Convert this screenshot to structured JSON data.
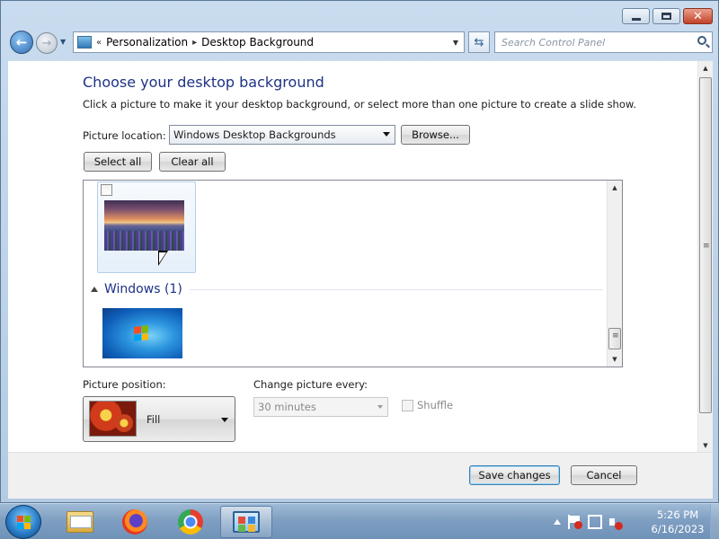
{
  "window": {
    "minimize_label": "Minimize",
    "maximize_label": "Maximize",
    "close_label": "Close"
  },
  "navbar": {
    "breadcrumb_chevron": "«",
    "breadcrumb": [
      "Personalization",
      "Desktop Background"
    ],
    "separator": "▸",
    "search_placeholder": "Search Control Panel"
  },
  "main": {
    "title": "Choose your desktop background",
    "instructions": "Click a picture to make it your desktop background, or select more than one picture to create a slide show.",
    "location_label": "Picture location:",
    "location_value": "Windows Desktop Backgrounds",
    "browse_label": "Browse...",
    "select_all_label": "Select all",
    "clear_all_label": "Clear all",
    "group_title": "Windows (1)",
    "position_label": "Picture position:",
    "position_value": "Fill",
    "change_label": "Change picture every:",
    "interval_value": "30 minutes",
    "shuffle_label": "Shuffle"
  },
  "footer": {
    "save_label": "Save changes",
    "cancel_label": "Cancel"
  },
  "taskbar": {
    "items": [
      "start",
      "windows-explorer",
      "firefox",
      "chrome",
      "control-panel"
    ],
    "time": "5:26 PM",
    "date": "6/16/2023"
  },
  "colors": {
    "title_blue": "#1e3287",
    "taskbar": "#7f9fc2",
    "window_frame": "#c9dcef"
  }
}
